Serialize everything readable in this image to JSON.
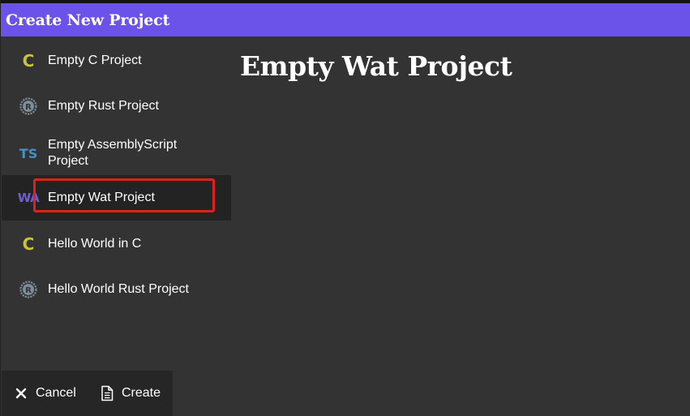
{
  "window": {
    "title": "Create New Project"
  },
  "sidebar": {
    "items": [
      {
        "label": "Empty C Project",
        "icon": "c-icon",
        "glyph": "C"
      },
      {
        "label": "Empty Rust Project",
        "icon": "rust-icon"
      },
      {
        "label": "Empty AssemblyScript Project",
        "icon": "typescript-icon",
        "glyph": "TS"
      },
      {
        "label": "Empty Wat Project",
        "icon": "wasm-icon",
        "glyph": "WA",
        "selected": true
      },
      {
        "label": "Hello World in C",
        "icon": "c-icon",
        "glyph": "C"
      },
      {
        "label": "Hello World Rust Project",
        "icon": "rust-icon"
      }
    ]
  },
  "main": {
    "title": "Empty Wat Project"
  },
  "footer": {
    "cancel_label": "Cancel",
    "create_label": "Create"
  },
  "colors": {
    "titlebar": "#6b52e8",
    "background": "#333333",
    "selected_row": "#232323",
    "highlight": "#e0211b",
    "c_icon": "#c9c33a",
    "ts_icon": "#4a8fc2",
    "wa_icon": "#6e5fd0"
  }
}
